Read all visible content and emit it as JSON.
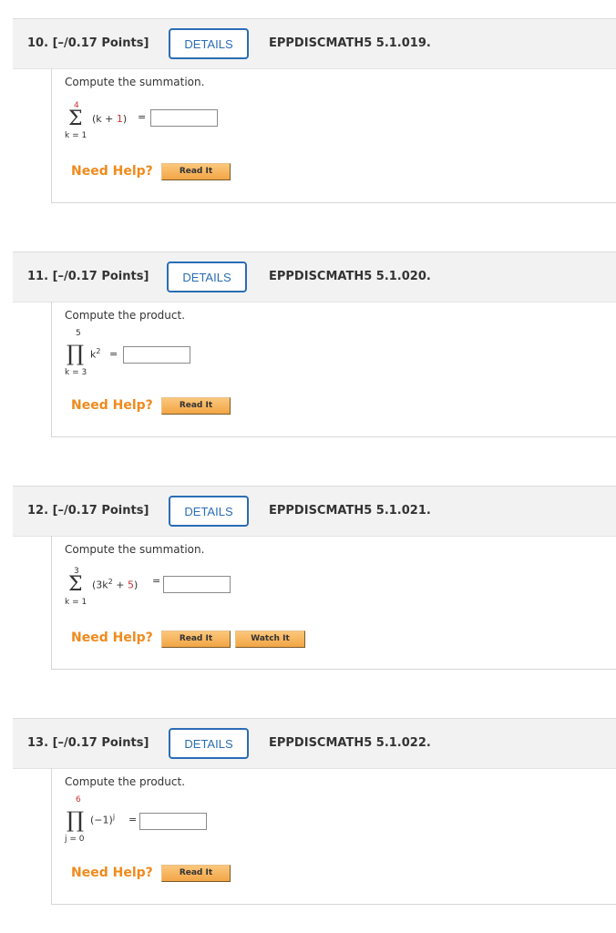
{
  "questions": [
    {
      "number": "10.",
      "points": "[–/0.17 Points]",
      "details_label": "DETAILS",
      "code": "EPPDISCMATH5 5.1.019.",
      "prompt": "Compute the summation.",
      "operator": "Σ",
      "upper": "4",
      "lower": "k = 1",
      "expr_pre": "(k + ",
      "expr_red": "1",
      "expr_post": ")",
      "expr_sup": "",
      "equals": "=",
      "answer_value": "",
      "need_help": "Need Help?",
      "buttons": [
        "Read It"
      ]
    },
    {
      "number": "11.",
      "points": "[–/0.17 Points]",
      "details_label": "DETAILS",
      "code": "EPPDISCMATH5 5.1.020.",
      "prompt": "Compute the product.",
      "operator": "∏",
      "upper": "5",
      "lower": "k = 3",
      "expr_pre": "k",
      "expr_sup": "2",
      "expr_red": "",
      "expr_post": "",
      "equals": "=",
      "answer_value": "",
      "need_help": "Need Help?",
      "buttons": [
        "Read It"
      ]
    },
    {
      "number": "12.",
      "points": "[–/0.17 Points]",
      "details_label": "DETAILS",
      "code": "EPPDISCMATH5 5.1.021.",
      "prompt": "Compute the summation.",
      "operator": "Σ",
      "upper": "3",
      "lower": "k = 1",
      "expr_pre": "(3k",
      "expr_sup": "2",
      "expr_mid": " + ",
      "expr_red": "5",
      "expr_post": ")",
      "equals": "=",
      "answer_value": "",
      "need_help": "Need Help?",
      "buttons": [
        "Read It",
        "Watch It"
      ]
    },
    {
      "number": "13.",
      "points": "[–/0.17 Points]",
      "details_label": "DETAILS",
      "code": "EPPDISCMATH5 5.1.022.",
      "prompt": "Compute the product.",
      "operator": "∏",
      "upper": "6",
      "lower": "j = 0",
      "expr_pre": "(−1)",
      "expr_sup": "j",
      "expr_red": "",
      "expr_post": "",
      "equals": "=",
      "answer_value": "",
      "need_help": "Need Help?",
      "buttons": [
        "Read It"
      ]
    }
  ],
  "colors": {
    "details_border": "#2a6db5",
    "need_help": "#f08a1c",
    "red_term": "#cc3333",
    "header_bg": "#f2f2f2"
  }
}
